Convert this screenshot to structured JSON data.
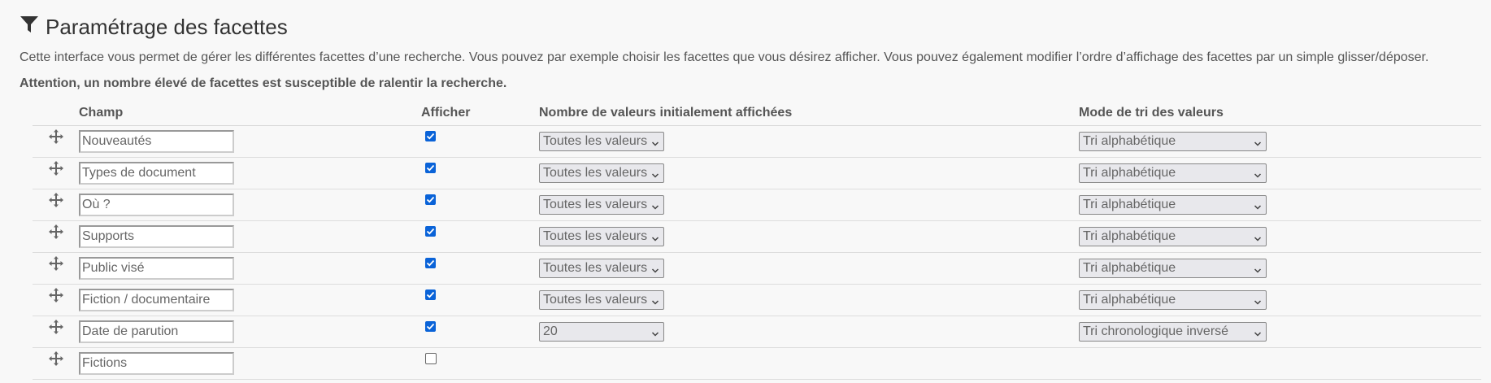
{
  "page": {
    "title": "Paramétrage des facettes",
    "description": "Cette interface vous permet de gérer les différentes facettes d’une recherche. Vous pouvez par exemple choisir les facettes que vous désirez afficher. Vous pouvez également modifier l’ordre d’affichage des facettes par un simple glisser/déposer.",
    "warning": "Attention, un nombre élevé de facettes est susceptible de ralentir la recherche."
  },
  "table": {
    "headers": {
      "field": "Champ",
      "show": "Afficher",
      "count": "Nombre de valeurs initialement affichées",
      "sort": "Mode de tri des valeurs"
    },
    "rows": [
      {
        "field": "Nouveautés",
        "show": true,
        "count": "Toutes les valeurs",
        "sort": "Tri alphabétique"
      },
      {
        "field": "Types de document",
        "show": true,
        "count": "Toutes les valeurs",
        "sort": "Tri alphabétique"
      },
      {
        "field": "Où ?",
        "show": true,
        "count": "Toutes les valeurs",
        "sort": "Tri alphabétique"
      },
      {
        "field": "Supports",
        "show": true,
        "count": "Toutes les valeurs",
        "sort": "Tri alphabétique"
      },
      {
        "field": "Public visé",
        "show": true,
        "count": "Toutes les valeurs",
        "sort": "Tri alphabétique"
      },
      {
        "field": "Fiction / documentaire",
        "show": true,
        "count": "Toutes les valeurs",
        "sort": "Tri alphabétique"
      },
      {
        "field": "Date de parution",
        "show": true,
        "count": "20",
        "sort": "Tri chronologique inversé"
      },
      {
        "field": "Fictions",
        "show": false,
        "count": null,
        "sort": null
      }
    ]
  },
  "icons": {
    "title_icon": "filter-icon",
    "row_handle": "move-arrows-icon",
    "select_arrow": "chevron-down-icon"
  },
  "colors": {
    "checkbox_checked": "#0a63d8",
    "page_background": "#f8f8f8"
  }
}
